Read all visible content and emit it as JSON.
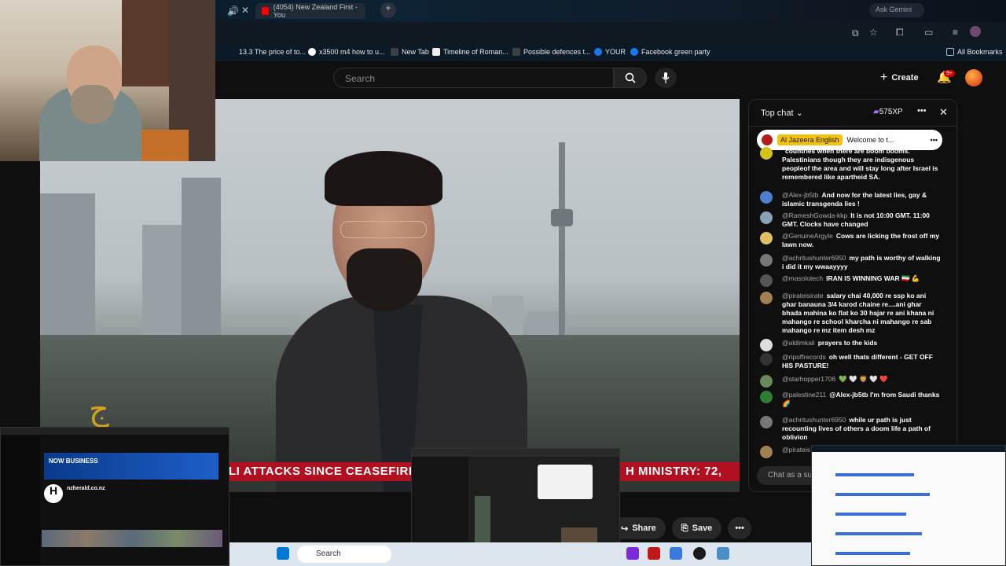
{
  "browser": {
    "active_tab_title": "(4054) New Zealand First - You",
    "bookmarks": [
      "13.3 The price of to...",
      "x3500 m4 how to u...",
      "New Tab",
      "Timeline of Roman...",
      "Possible defences t...",
      "YOUR",
      "Facebook green party"
    ],
    "all_bookmarks": "All Bookmarks",
    "ask_gemini": "Ask Gemini"
  },
  "youtube": {
    "search_placeholder": "Search",
    "create_label": "Create",
    "notifications": "9+",
    "share_label": "Share",
    "save_label": "Save"
  },
  "video": {
    "ticker_text": "LI ATTACKS SINCE CEASEFIRE ST",
    "ticker_text_right": "H MINISTRY: 72,"
  },
  "chat": {
    "header_title": "Top chat",
    "xp": "575XP",
    "pinned_channel": "Al Jazeera English",
    "pinned_text": "Welcome to t...",
    "input_placeholder": "Chat as a sub",
    "messages": [
      {
        "author": "",
        "text": "countries when there are boom booms. Palestinians though they are indisgenous peopleof the area and will stay long after Israel is remembered like apartheid SA.",
        "color": "#d4c21a"
      },
      {
        "author": "@Alex-jb5tb",
        "text": "And now for the latest lies, gay & islamic transgenda lies !",
        "color": "#4c7fd0"
      },
      {
        "author": "@RameshGowda-kkp",
        "text": "It is not 10:00 GMT. 11:00 GMT. Clocks have changed",
        "color": "#8aa2b8"
      },
      {
        "author": "@GenuineArgyle",
        "text": "Cows are licking the frost off my lawn now.",
        "color": "#e0c060"
      },
      {
        "author": "@achritushunter6950",
        "text": "my path is worthy of walking i did it my wwaayyyy",
        "color": "#777"
      },
      {
        "author": "@masolotech",
        "text": "IRAN IS WINNING WAR 🇮🇷 💪",
        "color": "#555"
      },
      {
        "author": "@pirateisirate",
        "text": "salary chai 40,000 re ssp ko ani ghar banauna 3/4 karod chaine re....ani ghar bhada mahina ko flat ko 30 hajar re ani khana ni mahango re school kharcha ni mahango re sab mahango re mz item desh mz",
        "color": "#a08050"
      },
      {
        "author": "@aldimkali",
        "text": "prayers to the kids",
        "color": "#ddd"
      },
      {
        "author": "@ripoffrecords",
        "text": "oh well thats different - GET OFF HIS PASTURE!",
        "color": "#333"
      },
      {
        "author": "@starhopper1706",
        "text": "💚 🤍 🦁 🤍 ❤️",
        "color": "#6a8a5a"
      },
      {
        "author": "@palestine211",
        "text": "@Alex-jb5tb I'm from Saudi thanks 🌈",
        "color": "#2e7d32"
      },
      {
        "author": "@achritushunter6950",
        "text": "while ur path is just recounting lives of others a doom life a path of oblivion",
        "color": "#777"
      },
      {
        "author": "@pirateis",
        "text": "",
        "color": "#a08050"
      }
    ]
  },
  "overlays": {
    "left_thumb_channel": "nzherald.co.nz",
    "left_thumb_banner": "NOW BUSINESS",
    "taskbar_search": "Search"
  }
}
